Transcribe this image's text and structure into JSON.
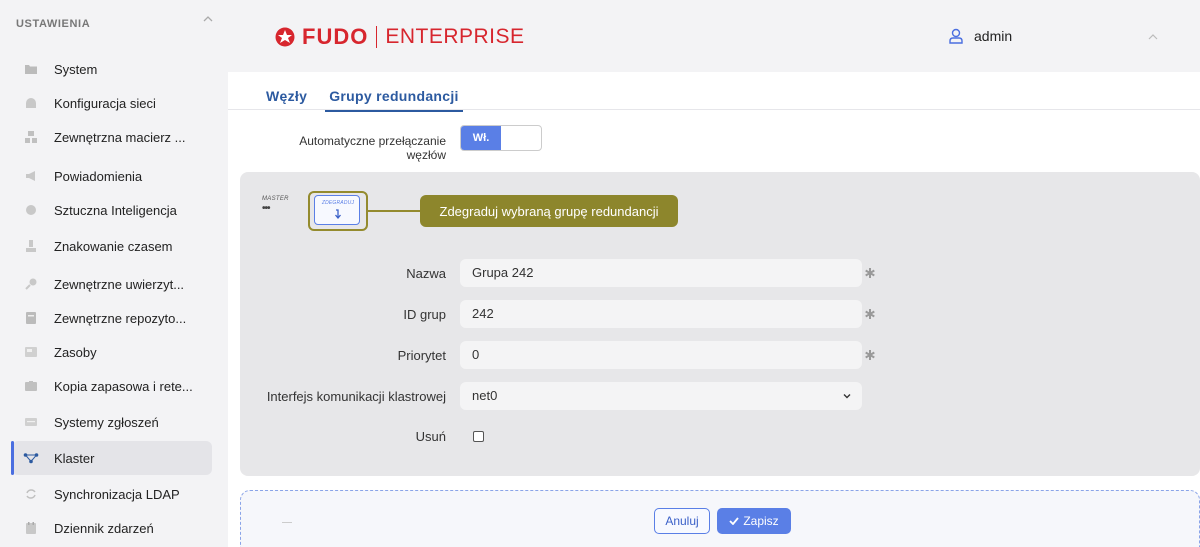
{
  "sidebar": {
    "header": "USTAWIENIA",
    "items": [
      {
        "label": "System",
        "icon": "folder-icon"
      },
      {
        "label": "Konfiguracja sieci",
        "icon": "network-icon"
      },
      {
        "label": "Zewnętrzna macierz ...",
        "icon": "storage-icon"
      },
      {
        "label": "Powiadomienia",
        "icon": "megaphone-icon"
      },
      {
        "label": "Sztuczna Inteligencja",
        "icon": "ai-icon"
      },
      {
        "label": "Znakowanie czasem",
        "icon": "stamp-icon"
      },
      {
        "label": "Zewnętrzne uwierzyt...",
        "icon": "key-icon"
      },
      {
        "label": "Zewnętrzne repozyto...",
        "icon": "repository-icon"
      },
      {
        "label": "Zasoby",
        "icon": "resources-icon"
      },
      {
        "label": "Kopia zapasowa i rete...",
        "icon": "backup-icon"
      },
      {
        "label": "Systemy zgłoszeń",
        "icon": "ticket-icon"
      },
      {
        "label": "Klaster",
        "icon": "cluster-icon",
        "active": true
      },
      {
        "label": "Synchronizacja LDAP",
        "icon": "sync-icon"
      },
      {
        "label": "Dziennik zdarzeń",
        "icon": "calendar-icon"
      }
    ]
  },
  "header": {
    "logo_brand": "FUDO",
    "logo_edition": "ENTERPRISE",
    "user": "admin"
  },
  "tabs": [
    {
      "label": "Węzły",
      "active": false
    },
    {
      "label": "Grupy redundancji",
      "active": true
    }
  ],
  "auto_switch": {
    "label_line1": "Automatyczne przełączanie",
    "label_line2": "węzłów",
    "toggle_on_label": "Wł."
  },
  "group": {
    "role_label": "MASTER",
    "role_dots": "•••",
    "degrade_button_label": "ZDEGRADUJ",
    "callout": "Zdegraduj wybraną grupę redundancji"
  },
  "form": {
    "name_label": "Nazwa",
    "name_value": "Grupa 242",
    "id_label": "ID grup",
    "id_value": "242",
    "priority_label": "Priorytet",
    "priority_value": "0",
    "interface_label": "Interfejs komunikacji klastrowej",
    "interface_value": "net0",
    "delete_label": "Usuń"
  },
  "actions": {
    "cancel": "Anuluj",
    "save": "Zapisz"
  },
  "colors": {
    "accent": "#5a7fe6",
    "brand": "#d7262e",
    "callout": "#8d862c"
  }
}
